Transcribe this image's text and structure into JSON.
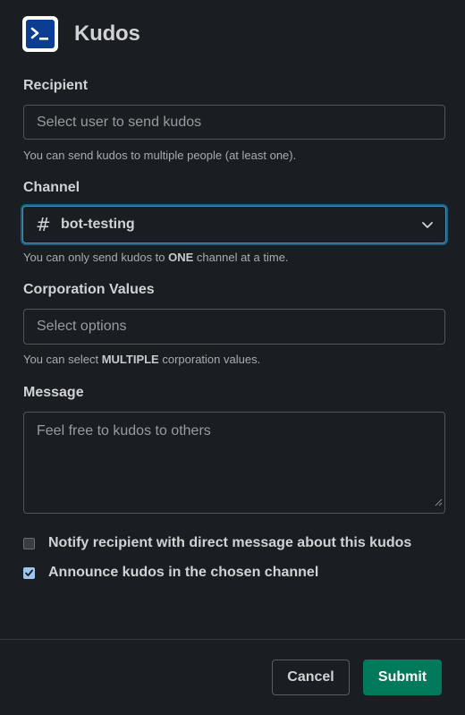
{
  "header": {
    "title": "Kudos",
    "app_icon": "terminal-prompt-icon"
  },
  "recipient": {
    "label": "Recipient",
    "placeholder": "Select user to send kudos",
    "hint": "You can send kudos to multiple people (at least one)."
  },
  "channel": {
    "label": "Channel",
    "value": "bot-testing",
    "hint_pre": "You can only send kudos to ",
    "hint_emph": "ONE",
    "hint_post": " channel at a time."
  },
  "values": {
    "label": "Corporation Values",
    "placeholder": "Select options",
    "hint_pre": "You can select ",
    "hint_emph": "MULTIPLE",
    "hint_post": " corporation values."
  },
  "message": {
    "label": "Message",
    "placeholder": "Feel free to kudos to others"
  },
  "options": [
    {
      "label": "Notify recipient with direct message about this kudos",
      "checked": false
    },
    {
      "label": "Announce kudos in the chosen channel",
      "checked": true
    }
  ],
  "footer": {
    "cancel_label": "Cancel",
    "submit_label": "Submit"
  },
  "colors": {
    "background": "#1a1d21",
    "submit": "#007a5a",
    "focus_ring": "#1d9bd1",
    "checkbox_checked": "#9fc4f0"
  }
}
